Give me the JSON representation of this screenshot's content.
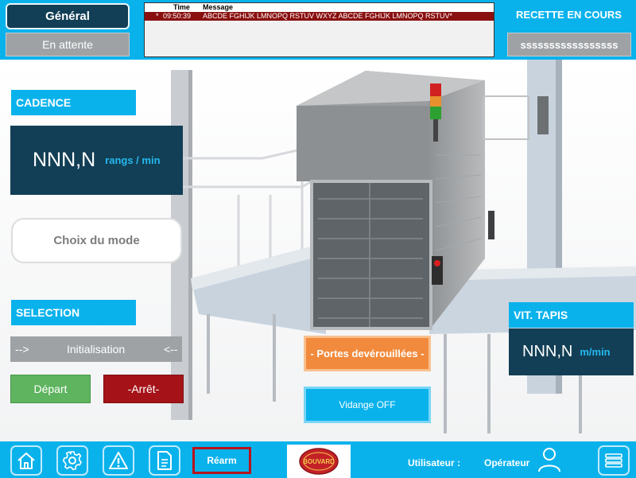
{
  "header": {
    "general_label": "Général",
    "waiting_label": "En attente",
    "recipe_title": "RECETTE EN COURS",
    "recipe_value": "sssssssssssssssss"
  },
  "alarms": {
    "col_time": "Time",
    "col_message": "Message",
    "rows": [
      {
        "marker": "*",
        "time": "09:50:39",
        "message": "ABCDE FGHIJK LMNOPQ RSTUV WXYZ ABCDE FGHIJK LMNOPQ RSTUV*"
      }
    ]
  },
  "cadence": {
    "title": "CADENCE",
    "value": "NNN,N",
    "unit": "rangs / min"
  },
  "mode": {
    "label": "Choix du mode"
  },
  "selection": {
    "title": "SELECTION",
    "left_arrow": "-->",
    "value": "Initialisation",
    "right_arrow": "<--",
    "start_label": "Départ",
    "stop_label": "-Arrêt-"
  },
  "doors": {
    "label": "- Portes devérouillées -"
  },
  "drain": {
    "label": "Vidange OFF"
  },
  "belt_speed": {
    "title": "VIT. TAPIS",
    "value": "NNN,N",
    "unit": "m/min"
  },
  "footer": {
    "rearm_label": "Réarm",
    "logo_text": "BOUVARD",
    "user_label": "Utilisateur :",
    "user_value": "Opérateur",
    "nav_icons": [
      "home-icon",
      "gear-icon",
      "warning-icon",
      "document-icon",
      "menu-icon",
      "user-icon"
    ]
  },
  "colors": {
    "accent_blue": "#0ab2ec",
    "dark_panel": "#123f55",
    "unit_blue": "#25b9ef",
    "gray_button": "#9ea2a5",
    "start_green": "#5fb45f",
    "stop_red": "#a51319",
    "doors_orange": "#f18a3c",
    "alarm_red": "#8a1010"
  }
}
